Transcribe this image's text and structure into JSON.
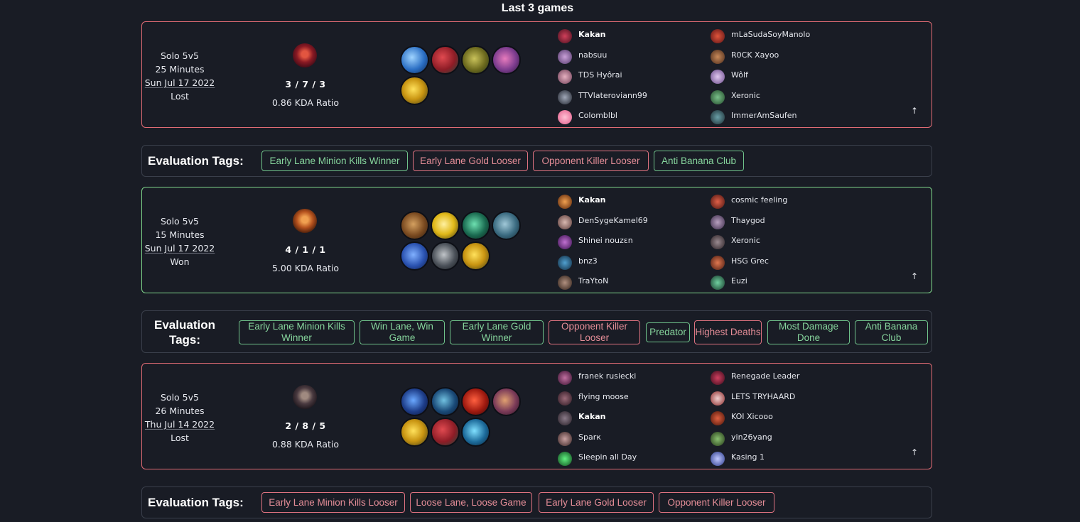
{
  "page_title": "Last 3 games",
  "games": [
    {
      "queue": "Solo 5v5",
      "duration": "25 Minutes",
      "date": "Sun Jul 17 2022",
      "result": "Lost",
      "kda": "3 / 7 / 3",
      "kda_ratio": "0.86 KDA Ratio",
      "champion_icon": "shyvana-champion-icon",
      "items": [
        "frost-gauntlet-item-icon",
        "mercury-treads-item-icon",
        "warmog-item-icon",
        "spirit-visage-item-icon",
        "oracle-lens-item-icon"
      ],
      "team1": [
        "Kakan",
        "nabsuu",
        "TDS Hyôrai",
        "TTVlateroviann99",
        "Colomblbl"
      ],
      "team2": [
        "mLaSudaSoyManolo",
        "R0CK Xayoo",
        "Wôlf",
        "Xeronic",
        "ImmerAmSaufen"
      ],
      "expand_icon": "↑"
    },
    {
      "queue": "Solo 5v5",
      "duration": "15 Minutes",
      "date": "Sun Jul 17 2022",
      "result": "Won",
      "kda": "4 / 1 / 1",
      "kda_ratio": "5.00 KDA Ratio",
      "champion_icon": "gnar-champion-icon",
      "items": [
        "aegis-shield-item-icon",
        "trinity-force-item-icon",
        "bramble-vest-item-icon",
        "plated-steelcaps-item-icon",
        "black-cleaver-item-icon",
        "pickaxe-item-icon",
        "oracle-lens-item-icon"
      ],
      "team1": [
        "Kakan",
        "DenSygeKamel69",
        "Shinei nouzεn",
        "bnz3",
        "TraYtoN"
      ],
      "team2": [
        "cosmic feeling",
        "Thaygod",
        "Xeronic",
        "HSG Grec",
        "Euzi"
      ],
      "expand_icon": "↑"
    },
    {
      "queue": "Solo 5v5",
      "duration": "26 Minutes",
      "date": "Thu Jul 14 2022",
      "result": "Lost",
      "kda": "2 / 8 / 5",
      "kda_ratio": "0.88 KDA Ratio",
      "champion_icon": "ryze-champion-icon",
      "items": [
        "everfrost-item-icon",
        "frozen-heart-item-icon",
        "sunfire-item-icon",
        "hextech-item-icon",
        "oracle-lens-item-icon",
        "mercury-treads-item-icon",
        "cosmic-drive-item-icon"
      ],
      "team1": [
        "franek rusiecki",
        "flying moose",
        "Kakan",
        "Sparк",
        "Sleepin all Day"
      ],
      "team2": [
        "Renegade Leader",
        "LETS TRYHAARD",
        "KOI Xicooo",
        "yin26yang",
        "Kasing 1"
      ],
      "expand_icon": "↑"
    }
  ],
  "evaluation": [
    {
      "label": "Evaluation Tags:",
      "tags": [
        {
          "text": "Early Lane Minion Kills Winner",
          "kind": "good"
        },
        {
          "text": "Early Lane Gold Looser",
          "kind": "bad"
        },
        {
          "text": "Opponent Killer Looser",
          "kind": "bad"
        },
        {
          "text": "Anti Banana Club",
          "kind": "good"
        }
      ]
    },
    {
      "label": "Evaluation Tags:",
      "tags": [
        {
          "text": "Early Lane Minion Kills Winner",
          "kind": "good"
        },
        {
          "text": "Win Lane, Win Game",
          "kind": "good"
        },
        {
          "text": "Early Lane Gold Winner",
          "kind": "good"
        },
        {
          "text": "Opponent Killer Looser",
          "kind": "bad"
        },
        {
          "text": "Predator",
          "kind": "good"
        },
        {
          "text": "Highest Deaths",
          "kind": "bad"
        },
        {
          "text": "Most Damage Done",
          "kind": "good"
        },
        {
          "text": "Anti Banana Club",
          "kind": "good"
        }
      ]
    },
    {
      "label": "Evaluation Tags:",
      "tags": [
        {
          "text": "Early Lane Minion Kills Looser",
          "kind": "bad"
        },
        {
          "text": "Loose Lane, Loose Game",
          "kind": "bad"
        },
        {
          "text": "Early Lane Gold Looser",
          "kind": "bad"
        },
        {
          "text": "Opponent Killer Looser",
          "kind": "bad"
        }
      ]
    }
  ],
  "colors": {
    "background": "#191c25",
    "loss_border": "#e06b74",
    "win_border": "#7fd68b",
    "good_tag": "#86d49c",
    "bad_tag": "#e48d97"
  }
}
